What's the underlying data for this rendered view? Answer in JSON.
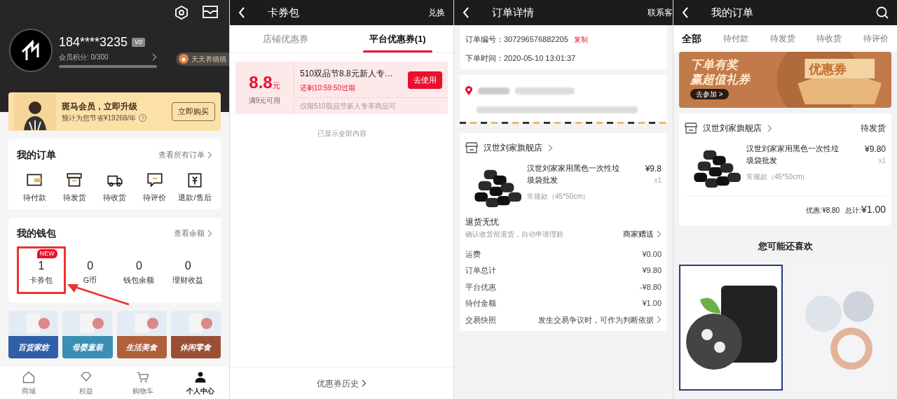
{
  "profile_screen": {
    "user": {
      "phone": "184****3235",
      "vip_badge": "V0",
      "points_label": "会员积分: 0/300"
    },
    "cat_pill": "天天养猫猫",
    "member_banner": {
      "title": "斑马会员，立即升级",
      "subtitle": "预计为您节省¥19268/年",
      "help": "?",
      "button": "立即购买"
    },
    "orders": {
      "title": "我的订单",
      "link": "查看所有订单",
      "items": [
        {
          "kind": "wallet",
          "label": "待付款"
        },
        {
          "kind": "box",
          "label": "待发货"
        },
        {
          "kind": "truck",
          "label": "待收货"
        },
        {
          "kind": "comment",
          "label": "待评价"
        },
        {
          "kind": "refund",
          "label": "退款/售后"
        }
      ]
    },
    "wallet": {
      "title": "我的钱包",
      "link": "查看余额",
      "items": [
        {
          "value": "1",
          "label": "卡券包",
          "badge": "NEW",
          "highlighted": true
        },
        {
          "value": "0",
          "label": "G币",
          "highlighted": false
        },
        {
          "value": "0",
          "label": "钱包余额",
          "highlighted": false
        },
        {
          "value": "0",
          "label": "理财收益",
          "highlighted": false
        }
      ]
    },
    "tiles": [
      {
        "title": "百货家纺",
        "color": "#2f5fa8"
      },
      {
        "title": "母婴童装",
        "color": "#3b8fb5"
      },
      {
        "title": "生活美食",
        "color": "#b0603a"
      },
      {
        "title": "休闲零食",
        "color": "#9a4f35"
      }
    ],
    "nav": [
      {
        "kind": "home",
        "label": "商城",
        "selected": false
      },
      {
        "kind": "gem",
        "label": "权益",
        "selected": false
      },
      {
        "kind": "cart",
        "label": "购物车",
        "selected": false
      },
      {
        "kind": "user",
        "label": "个人中心",
        "selected": true
      }
    ]
  },
  "coupon_screen": {
    "title": "卡券包",
    "action": "兑换",
    "tabs": [
      {
        "label": "店铺优惠券",
        "selected": false
      },
      {
        "label": "平台优惠券(1)",
        "selected": true
      }
    ],
    "coupon": {
      "amount": "8.8",
      "unit": "元",
      "condition": "满9元可用",
      "name": "510双品节8.8元新人专…",
      "expiry": "还剩10:59:50过期",
      "button": "去使用",
      "scope": "仅限510双品节新人专享商品可"
    },
    "end_note": "已显示全部内容",
    "history": "优惠券历史"
  },
  "order_detail_screen": {
    "title": "订单详情",
    "action": "联系客",
    "order_no_label": "订单编号：",
    "order_no": "307296576882205",
    "copy": "复制",
    "time_label": "下单时间：",
    "time": "2020-05-10 13:01:37",
    "store": "汉世刘家旗舰店",
    "product": {
      "name": "汉世刘家家用黑色一次性垃圾袋批发",
      "price": "¥9.8",
      "qty": "x1",
      "spec": "常规款（45*50cm）"
    },
    "insurance": {
      "title": "退货无忧",
      "note": "确认收货前退货，自动申请理赔",
      "value": "商家赠送"
    },
    "rows": [
      {
        "kind": "fee",
        "label": "运费",
        "value": "¥0.00"
      },
      {
        "kind": "fee",
        "label": "订单总计",
        "value": "¥9.80"
      },
      {
        "kind": "fee",
        "label": "平台优惠",
        "value": "-¥8.80"
      },
      {
        "kind": "fee",
        "label": "待付金额",
        "value": "¥1.00"
      },
      {
        "kind": "link",
        "label": "交易快照",
        "value": "发生交易争议时，可作为判断依据"
      }
    ]
  },
  "orders_screen": {
    "title": "我的订单",
    "tabs": [
      {
        "label": "全部",
        "selected": true
      },
      {
        "label": "待付款",
        "selected": false
      },
      {
        "label": "待发货",
        "selected": false
      },
      {
        "label": "待收货",
        "selected": false
      },
      {
        "label": "待评价",
        "selected": false
      }
    ],
    "banner": {
      "line1": "下单有奖",
      "line2": "赢超值礼券",
      "button": "去参加 >",
      "ticket": "优惠券"
    },
    "order": {
      "store": "汉世刘家旗舰店",
      "status": "待发货",
      "name": "汉世刘家家用黑色一次性垃圾袋批发",
      "price": "¥9.80",
      "qty": "x1",
      "spec": "常规款（45*50cm）",
      "discount": "优惠:¥8.80",
      "total_label": "总计:",
      "total": "¥1.00"
    },
    "recommend_title": "您可能还喜欢"
  }
}
